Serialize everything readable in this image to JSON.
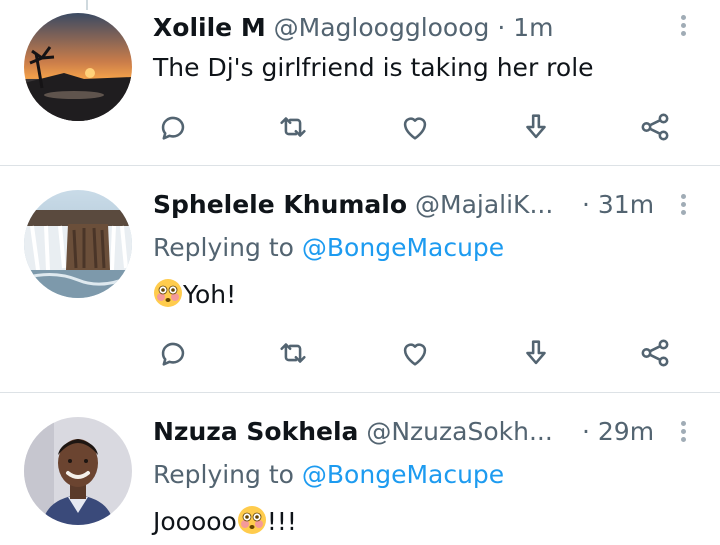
{
  "tweets": [
    {
      "name": "Xolile M",
      "handle": "@Magloogglooog",
      "separator": "·",
      "time": "1m",
      "text": "The Dj's girlfriend is taking her role",
      "avatar": "sunset-avatar"
    },
    {
      "name": "Sphelele Khumalo",
      "handle": "@MajaliK...",
      "separator": "·",
      "time": "31m",
      "replying_label": "Replying to",
      "replying_to": "@BongeMacupe",
      "text_after_emoji": "Yoh!",
      "emoji": "flushed-face",
      "avatar": "waterfall-avatar"
    },
    {
      "name": "Nzuza Sokhela",
      "handle": "@NzuzaSokh...",
      "separator": "·",
      "time": "29m",
      "replying_label": "Replying to",
      "replying_to": "@BongeMacupe",
      "text_before_emoji": "Jooooo",
      "text_after_emoji": "!!!",
      "emoji": "flushed-face",
      "avatar": "person-avatar"
    }
  ],
  "icons": {
    "reply": "reply-icon",
    "retweet": "retweet-icon",
    "like": "heart-icon",
    "download": "download-icon",
    "share": "share-icon",
    "more": "more-icon"
  },
  "colors": {
    "text": "#0f1419",
    "secondary": "#536471",
    "accent": "#1d9bf0",
    "icon": "#536471"
  }
}
